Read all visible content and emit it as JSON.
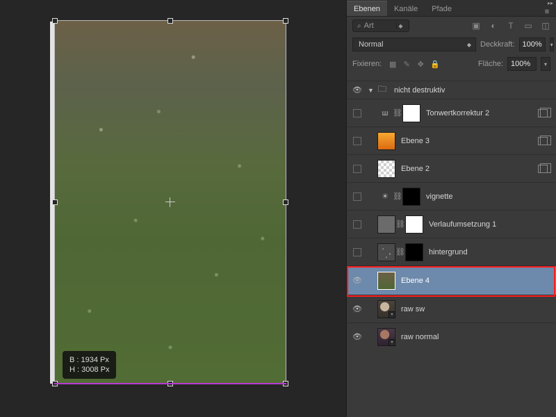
{
  "canvas": {
    "info_w_label": "B : 1934 Px",
    "info_h_label": "H : 3008 Px"
  },
  "panel": {
    "tabs": {
      "layers": "Ebenen",
      "channels": "Kanäle",
      "paths": "Pfade"
    },
    "filter": {
      "label": "Art"
    },
    "toolbar_icons": {
      "image": "image-icon",
      "adjust": "adjust-icon",
      "type": "type-icon",
      "shape": "shape-icon",
      "smart": "smartobj-icon"
    },
    "blend_mode": "Normal",
    "opacity_label": "Deckkraft:",
    "opacity_value": "100%",
    "lock_label": "Fixieren:",
    "fill_label": "Fläche:",
    "fill_value": "100%"
  },
  "layers": {
    "group_name": "nicht destruktiv",
    "items": [
      {
        "name": "Tonwertkorrektur 2"
      },
      {
        "name": "Ebene 3"
      },
      {
        "name": "Ebene 2"
      },
      {
        "name": "vignette"
      },
      {
        "name": "Verlaufumsetzung 1"
      },
      {
        "name": "hintergrund"
      },
      {
        "name": "Ebene 4"
      },
      {
        "name": "raw sw"
      },
      {
        "name": "raw normal"
      }
    ]
  }
}
